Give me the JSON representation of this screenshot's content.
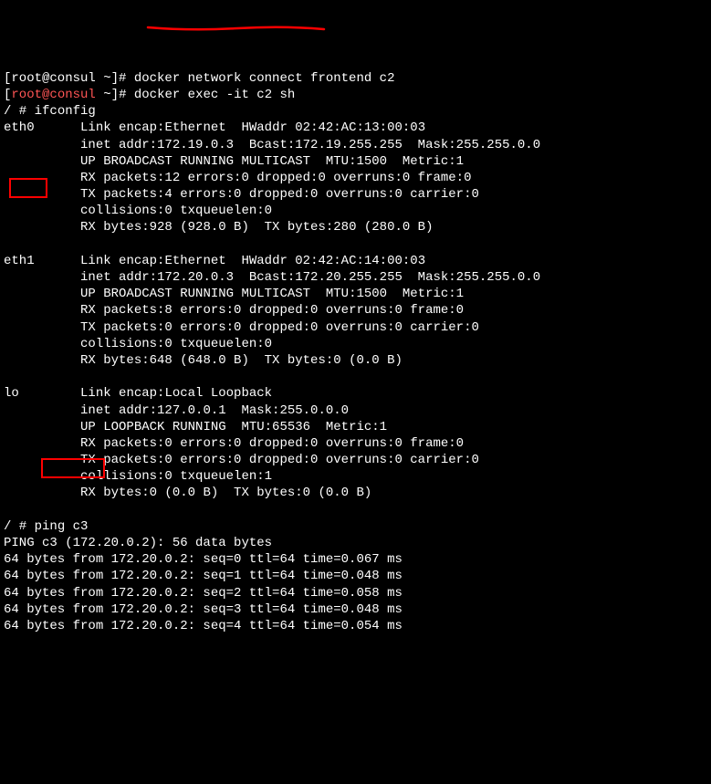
{
  "prompt": {
    "user": "root",
    "host": "consul",
    "path": "~",
    "symbol": "#"
  },
  "commands": {
    "docker_exec": "docker exec -it c2 sh",
    "ifconfig": "ifconfig",
    "ping": "ping c3"
  },
  "top_truncated": "[root@consul ~]# docker network connect frontend c2",
  "eth0": {
    "name": "eth0",
    "line1": "Link encap:Ethernet  HWaddr 02:42:AC:13:00:03",
    "line2": "inet addr:172.19.0.3  Bcast:172.19.255.255  Mask:255.255.0.0",
    "line3": "UP BROADCAST RUNNING MULTICAST  MTU:1500  Metric:1",
    "line4": "RX packets:12 errors:0 dropped:0 overruns:0 frame:0",
    "line5": "TX packets:4 errors:0 dropped:0 overruns:0 carrier:0",
    "line6": "collisions:0 txqueuelen:0",
    "line7": "RX bytes:928 (928.0 B)  TX bytes:280 (280.0 B)"
  },
  "eth1": {
    "name": "eth1",
    "line1": "Link encap:Ethernet  HWaddr 02:42:AC:14:00:03",
    "line2": "inet addr:172.20.0.3  Bcast:172.20.255.255  Mask:255.255.0.0",
    "line3": "UP BROADCAST RUNNING MULTICAST  MTU:1500  Metric:1",
    "line4": "RX packets:8 errors:0 dropped:0 overruns:0 frame:0",
    "line5": "TX packets:0 errors:0 dropped:0 overruns:0 carrier:0",
    "line6": "collisions:0 txqueuelen:0",
    "line7": "RX bytes:648 (648.0 B)  TX bytes:0 (0.0 B)"
  },
  "lo": {
    "name": "lo",
    "line1": "Link encap:Local Loopback",
    "line2": "inet addr:127.0.0.1  Mask:255.0.0.0",
    "line3": "UP LOOPBACK RUNNING  MTU:65536  Metric:1",
    "line4": "RX packets:0 errors:0 dropped:0 overruns:0 frame:0",
    "line5": "TX packets:0 errors:0 dropped:0 overruns:0 carrier:0",
    "line6": "collisions:0 txqueuelen:1",
    "line7": "RX bytes:0 (0.0 B)  TX bytes:0 (0.0 B)"
  },
  "shell_prompt": "/ # ",
  "ping_output": {
    "header": "PING c3 (172.20.0.2): 56 data bytes",
    "line1": "64 bytes from 172.20.0.2: seq=0 ttl=64 time=0.067 ms",
    "line2": "64 bytes from 172.20.0.2: seq=1 ttl=64 time=0.048 ms",
    "line3": "64 bytes from 172.20.0.2: seq=2 ttl=64 time=0.058 ms",
    "line4": "64 bytes from 172.20.0.2: seq=3 ttl=64 time=0.048 ms",
    "line5": "64 bytes from 172.20.0.2: seq=4 ttl=64 time=0.054 ms"
  }
}
